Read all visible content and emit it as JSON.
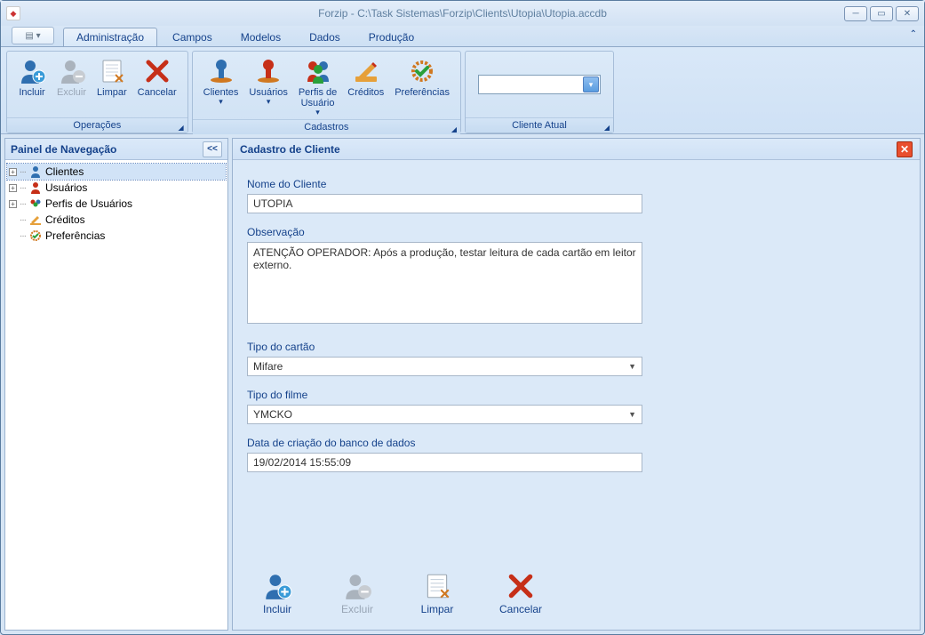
{
  "window": {
    "title": "Forzip - C:\\Task Sistemas\\Forzip\\Clients\\Utopia\\Utopia.accdb"
  },
  "tabs": {
    "administracao": "Administração",
    "campos": "Campos",
    "modelos": "Modelos",
    "dados": "Dados",
    "producao": "Produção"
  },
  "ribbon": {
    "operacoes": {
      "label": "Operações",
      "incluir": "Incluir",
      "excluir": "Excluir",
      "limpar": "Limpar",
      "cancelar": "Cancelar"
    },
    "cadastros": {
      "label": "Cadastros",
      "clientes": "Clientes",
      "usuarios": "Usuários",
      "perfis": "Perfis de\nUsuário",
      "creditos": "Créditos",
      "preferencias": "Preferências"
    },
    "clienteAtual": {
      "label": "Cliente Atual"
    }
  },
  "nav": {
    "title": "Painel de Navegação",
    "items": {
      "clientes": "Clientes",
      "usuarios": "Usuários",
      "perfis": "Perfis de Usuários",
      "creditos": "Créditos",
      "preferencias": "Preferências"
    }
  },
  "main": {
    "title": "Cadastro de Cliente",
    "labels": {
      "nome": "Nome do Cliente",
      "obs": "Observação",
      "tipoCartao": "Tipo do cartão",
      "tipoFilme": "Tipo do filme",
      "dataCriacao": "Data de criação do banco de dados"
    },
    "values": {
      "nome": "UTOPIA",
      "obs": "ATENÇÃO OPERADOR: Após a produção, testar leitura de cada cartão em leitor externo.",
      "tipoCartao": "Mifare",
      "tipoFilme": "YMCKO",
      "dataCriacao": "19/02/2014 15:55:09"
    },
    "actions": {
      "incluir": "Incluir",
      "excluir": "Excluir",
      "limpar": "Limpar",
      "cancelar": "Cancelar"
    }
  }
}
